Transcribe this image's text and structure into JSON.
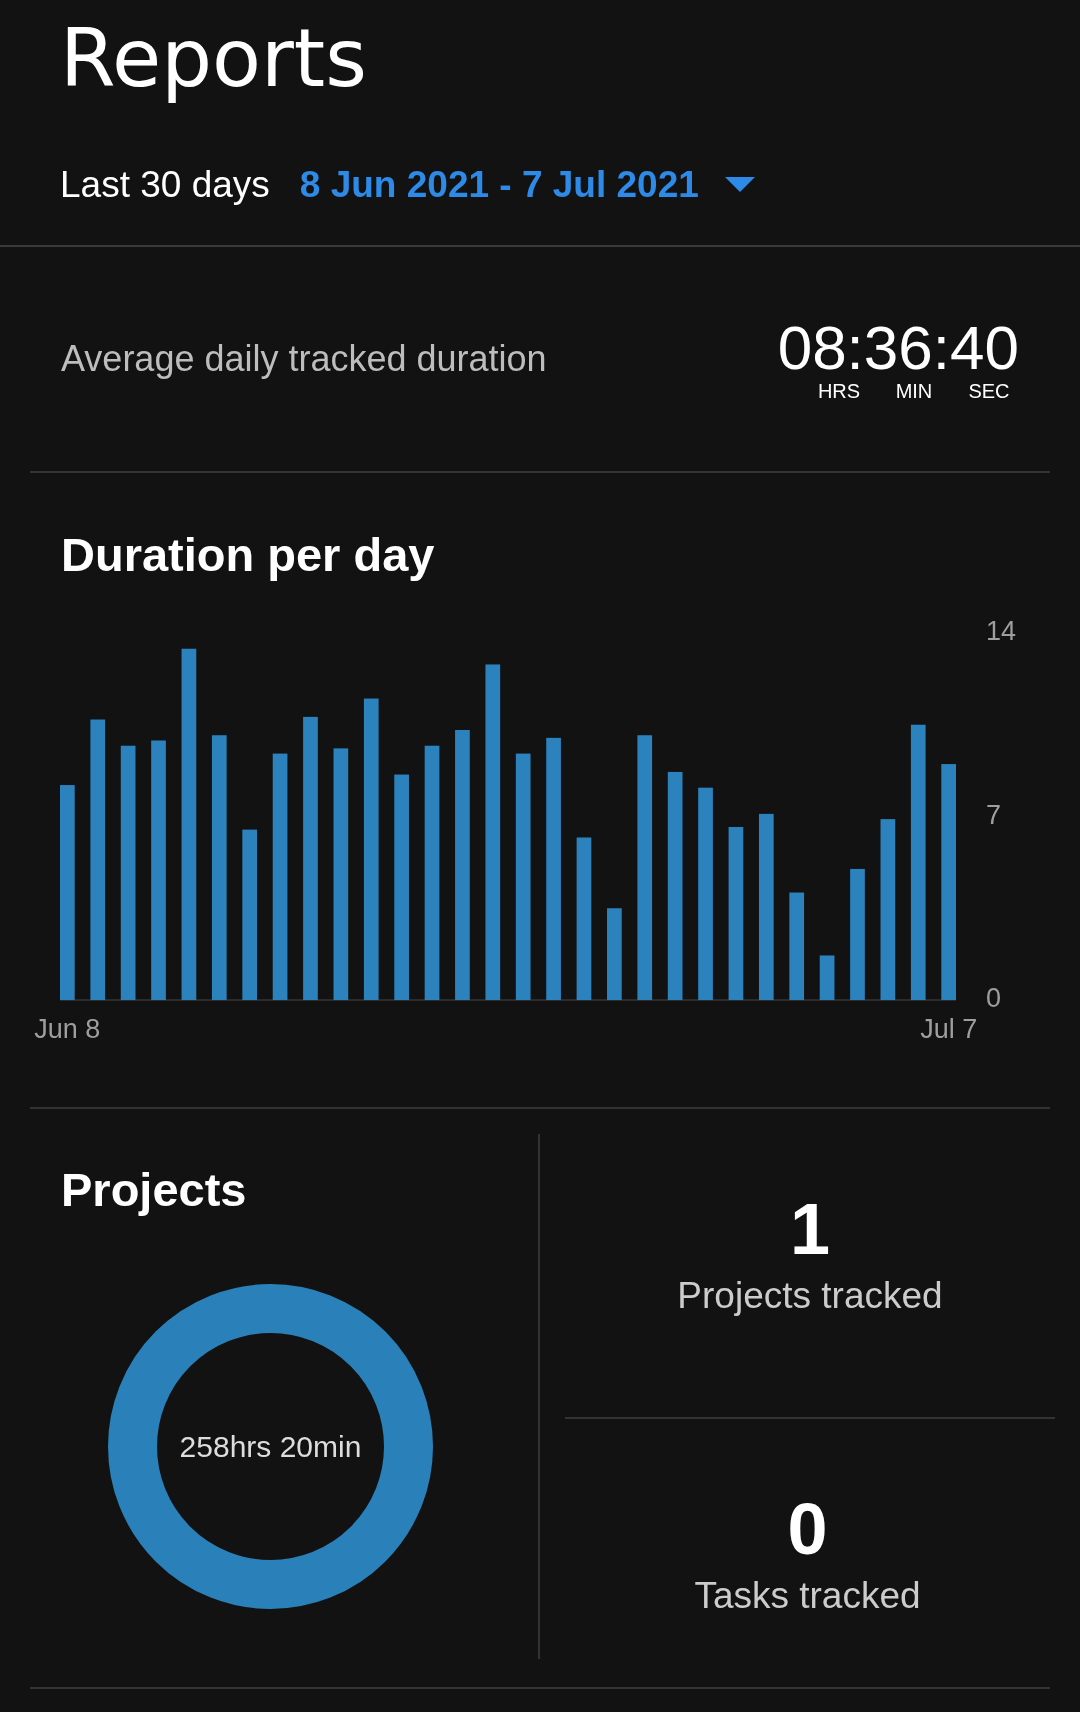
{
  "header": {
    "title": "Reports",
    "range_label": "Last 30 days",
    "date_range": "8 Jun 2021 - 7 Jul 2021"
  },
  "average": {
    "label": "Average daily tracked duration",
    "time": "08:36:40",
    "units": [
      "HRS",
      "MIN",
      "SEC"
    ]
  },
  "duration_chart": {
    "title": "Duration per day",
    "chart_data": {
      "type": "bar",
      "categories": [
        "Jun 8",
        null,
        null,
        null,
        null,
        null,
        null,
        null,
        null,
        null,
        null,
        null,
        null,
        null,
        null,
        null,
        null,
        null,
        null,
        null,
        null,
        null,
        null,
        null,
        null,
        null,
        null,
        null,
        null,
        "Jul 7"
      ],
      "series": [
        {
          "color": "#2b82bd",
          "values": [
            8.2,
            10.7,
            9.7,
            9.9,
            13.4,
            10.1,
            6.5,
            9.4,
            10.8,
            9.6,
            11.5,
            8.6,
            9.7,
            10.3,
            12.8,
            9.4,
            10.0,
            6.2,
            3.5,
            10.1,
            8.7,
            8.1,
            6.6,
            7.1,
            4.1,
            1.7,
            5.0,
            6.9,
            10.5,
            9.0
          ]
        }
      ],
      "ylim": [
        0,
        14
      ],
      "yticks": [
        0,
        7,
        14
      ]
    }
  },
  "projects": {
    "title": "Projects",
    "donut_label": "258hrs 20min"
  },
  "stats": [
    {
      "value": "1",
      "label": "Projects tracked"
    },
    {
      "value": "0",
      "label": "Tasks tracked"
    }
  ]
}
